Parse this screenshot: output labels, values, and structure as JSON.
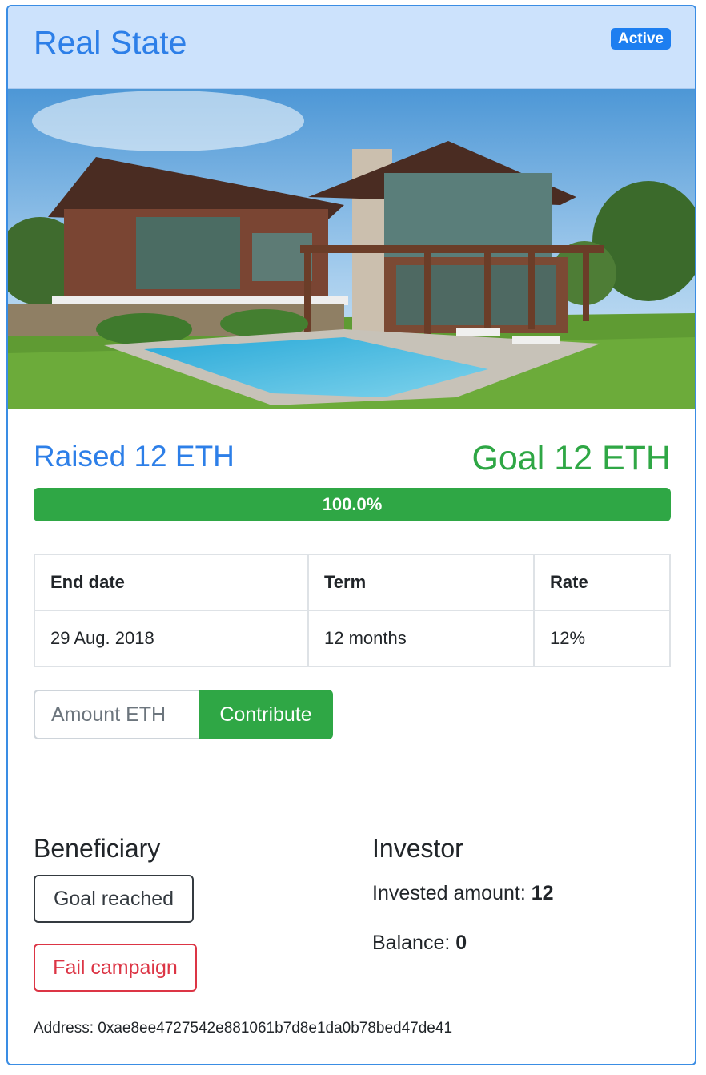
{
  "campaign": {
    "title": "Real State",
    "status_badge": "Active"
  },
  "funding": {
    "raised": "Raised 12 ETH",
    "goal": "Goal 12 ETH",
    "progress_label": "100.0%",
    "progress_fraction": 1.0
  },
  "terms_table": {
    "headers": [
      "End date",
      "Term",
      "Rate"
    ],
    "values": [
      "29 Aug. 2018",
      "12 months",
      "12%"
    ]
  },
  "contribute": {
    "placeholder": "Amount ETH",
    "button_label": "Contribute"
  },
  "beneficiary": {
    "heading": "Beneficiary",
    "goal_button": "Goal reached",
    "fail_button": "Fail campaign"
  },
  "investor": {
    "heading": "Investor",
    "invested_label": "Invested amount: ",
    "invested_value": "12",
    "balance_label": "Balance: ",
    "balance_value": "0"
  },
  "address": {
    "label": "Address: ",
    "value": "0xae8ee4727542e881061b7d8e1da0b78bed47de41"
  },
  "colors": {
    "primary": "#2d7fe8",
    "success": "#2fa745",
    "danger": "#dc3545",
    "header_bg": "#cce2fc",
    "border": "#3a8de4"
  }
}
